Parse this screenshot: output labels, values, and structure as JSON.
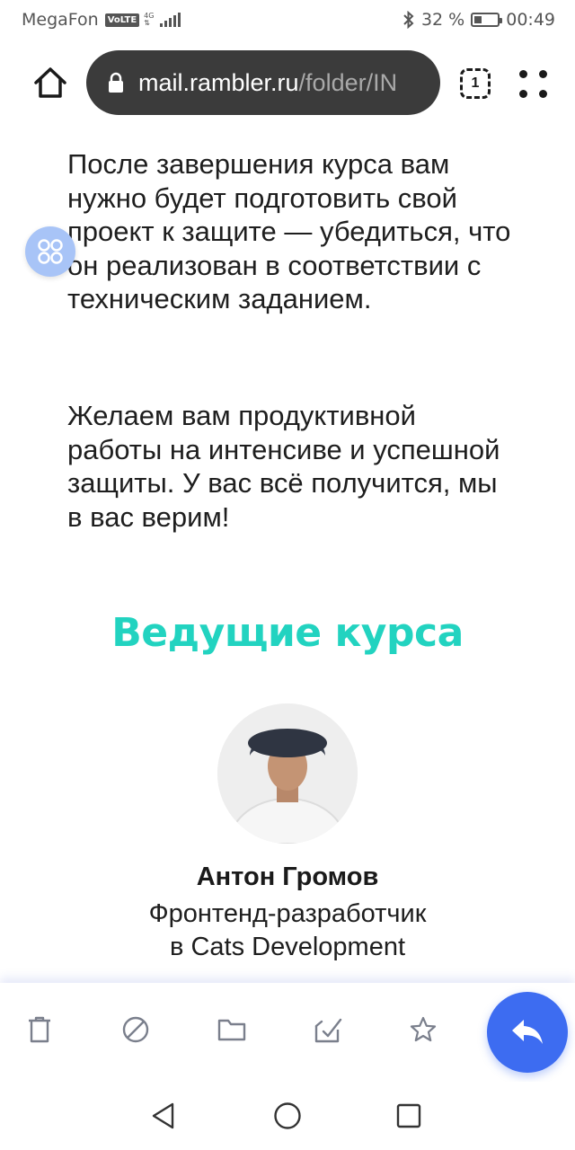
{
  "status_bar": {
    "carrier": "MegaFon",
    "volte": "VoLTE",
    "network": "4G",
    "battery_percent": "32 %",
    "battery_level": 0.32,
    "time": "00:49"
  },
  "browser": {
    "url_host": "mail.rambler.ru",
    "url_path": "/folder/IN",
    "tab_count": "1"
  },
  "content": {
    "paragraph1": "После завершения курса вам нужно будет подготовить свой проект к защите — убедиться, что он реализован в соответствии с техническим заданием.",
    "paragraph2": "Желаем вам продуктивной работы на интенсиве и успешной защиты. У вас всё получится, мы в вас верим!",
    "section_title": "Ведущие курса",
    "person": {
      "name": "Антон Громов",
      "role": "Фронтенд-разработчик в Cats Development"
    }
  },
  "toolbar": {
    "items": [
      "delete-icon",
      "spam-icon",
      "folder-icon",
      "mark-read-icon",
      "star-icon"
    ],
    "reply": "reply-icon"
  },
  "colors": {
    "accent_title": "#22d3c0",
    "reply_button": "#3d6cf1",
    "apps_button": "#a8c4f7",
    "url_bar": "#3b3b3b"
  }
}
